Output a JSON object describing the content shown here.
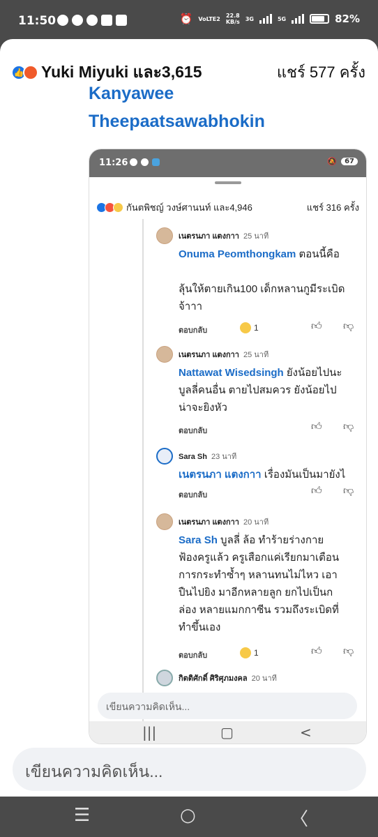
{
  "status": {
    "time": "11:50",
    "network": "VoLTE2",
    "speed": "22.8",
    "speed_unit": "KB/s",
    "sig1": "3G",
    "sig2": "5G",
    "battery": "82%"
  },
  "post": {
    "reaction_names": "Yuki Miyuki และ3,615",
    "shares": "แชร์ 577 ครั้ง",
    "name_line1": "Kanyawee",
    "name_line2": "Theepaatsawabhokin"
  },
  "inner": {
    "time": "11:26",
    "battery": "67",
    "reaction_names": "กันตพิชญ์ วงษ์ศานนท์ และ4,946",
    "shares": "แชร์ 316 ครั้ง",
    "reply_label": "ตอบกลับ",
    "comments": [
      {
        "author": "เนตรนภา แตงกาา",
        "ago": "25 นาที",
        "mention": "Onuma Peomthongkam",
        "text": " ตอนนี้คือ\n\nลุ้นให้ตายเกิน100 เด็กหลานกูมีระเบิด\nจ้าาา",
        "reaction_count": "1"
      },
      {
        "author": "เนตรนภา แตงกาา",
        "ago": "25 นาที",
        "mention": "Nattawat Wisedsingh",
        "text": " ยังน้อยไปนะ\nบูลลี่คนอื่น ตายไปสมควร ยังน้อยไป\nน่าจะยิงหัว"
      },
      {
        "author": "Sara Sh",
        "ago": "23 นาที",
        "mention": "เนตรนภา แตงกาา",
        "text": " เรื่องมันเป็นมายังไ"
      },
      {
        "author": "เนตรนภา แตงกาา",
        "ago": "20 นาที",
        "mention": "Sara Sh",
        "text": " บูลลี่ ล้อ ทำร้ายร่างกาย\nฟ้องครูแล้ว ครูเสือกแค่เรียกมาเตือน\nการกระทำซ้ำๆ หลานทนไม่ไหว เอา\nปืนไปยิง มาอีกหลายลูก ยกไปเป็นก\nล่อง หลายแมกกาซีน รวมถึงระเบิดที่\nทำขึ้นเอง",
        "reaction_count": "1"
      },
      {
        "author": "กิตติศักดิ์ ศิริศุภมงคล",
        "ago": "20 นาที"
      }
    ],
    "compose_placeholder": "เขียนความคิดเห็น..."
  },
  "compose_placeholder": "เขียนความคิดเห็น..."
}
